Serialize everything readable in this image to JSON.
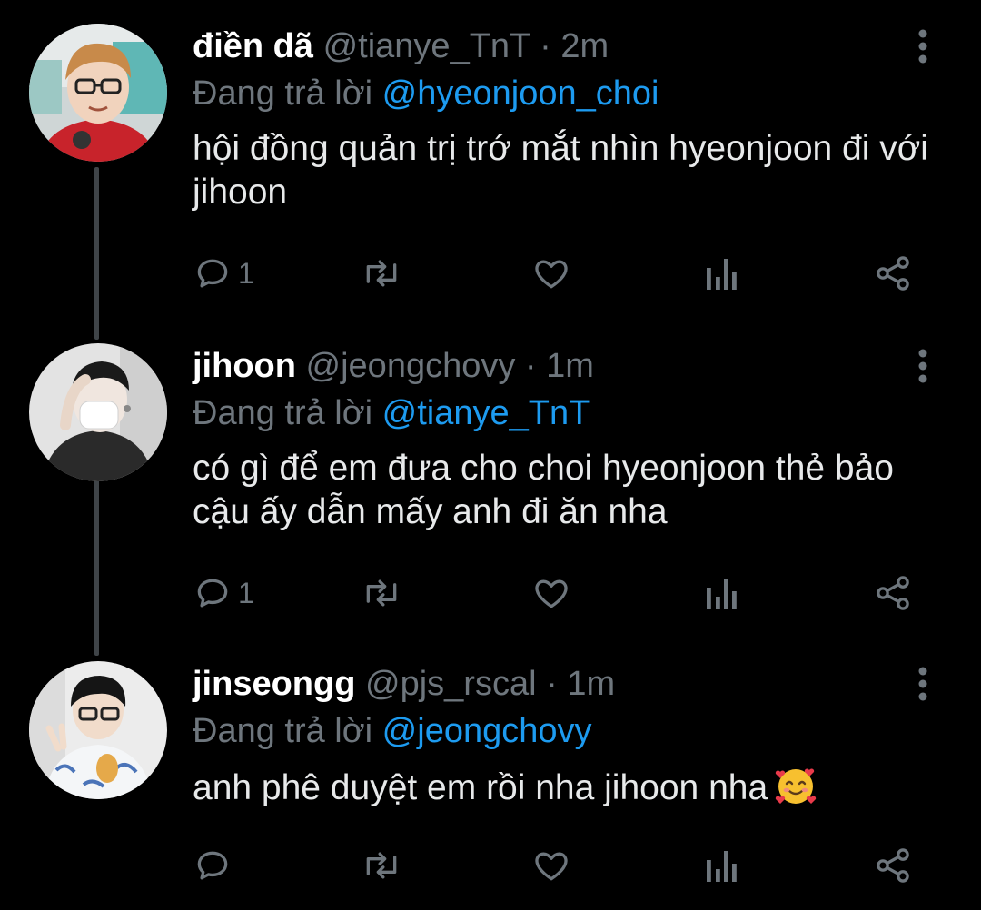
{
  "theme": {
    "background": "#000000",
    "text": "#e7e9ea",
    "muted": "#6e767d",
    "accent": "#1d9bf0",
    "thread_line": "#3f4448"
  },
  "tweets": [
    {
      "display_name": "điền dã",
      "handle": "@tianye_TnT",
      "separator": "·",
      "time": "2m",
      "replying_prefix": "Đang trả lời",
      "replying_to": "@hyeonjoon_choi",
      "body": "hội đồng quản trị trớ mắt nhìn hyeonjoon đi với jihoon",
      "reply_count": "1",
      "icons": [
        "reply-icon",
        "retweet-icon",
        "like-icon",
        "analytics-icon",
        "share-icon",
        "more-vertical-icon"
      ]
    },
    {
      "display_name": "jihoon",
      "handle": "@jeongchovy",
      "separator": "·",
      "time": "1m",
      "replying_prefix": "Đang trả lời",
      "replying_to": "@tianye_TnT",
      "body": "có gì để em đưa cho choi hyeonjoon thẻ bảo cậu ấy dẫn mấy anh đi ăn nha",
      "reply_count": "1",
      "icons": [
        "reply-icon",
        "retweet-icon",
        "like-icon",
        "analytics-icon",
        "share-icon",
        "more-vertical-icon"
      ]
    },
    {
      "display_name": "jinseongg",
      "handle": "@pjs_rscal",
      "separator": "·",
      "time": "1m",
      "replying_prefix": "Đang trả lời",
      "replying_to": "@jeongchovy",
      "body": "anh phê duyệt em rồi nha jihoon nha",
      "emoji": "smiling-face-with-hearts-emoji",
      "reply_count": "",
      "icons": [
        "reply-icon",
        "retweet-icon",
        "like-icon",
        "analytics-icon",
        "share-icon",
        "more-vertical-icon"
      ]
    }
  ]
}
